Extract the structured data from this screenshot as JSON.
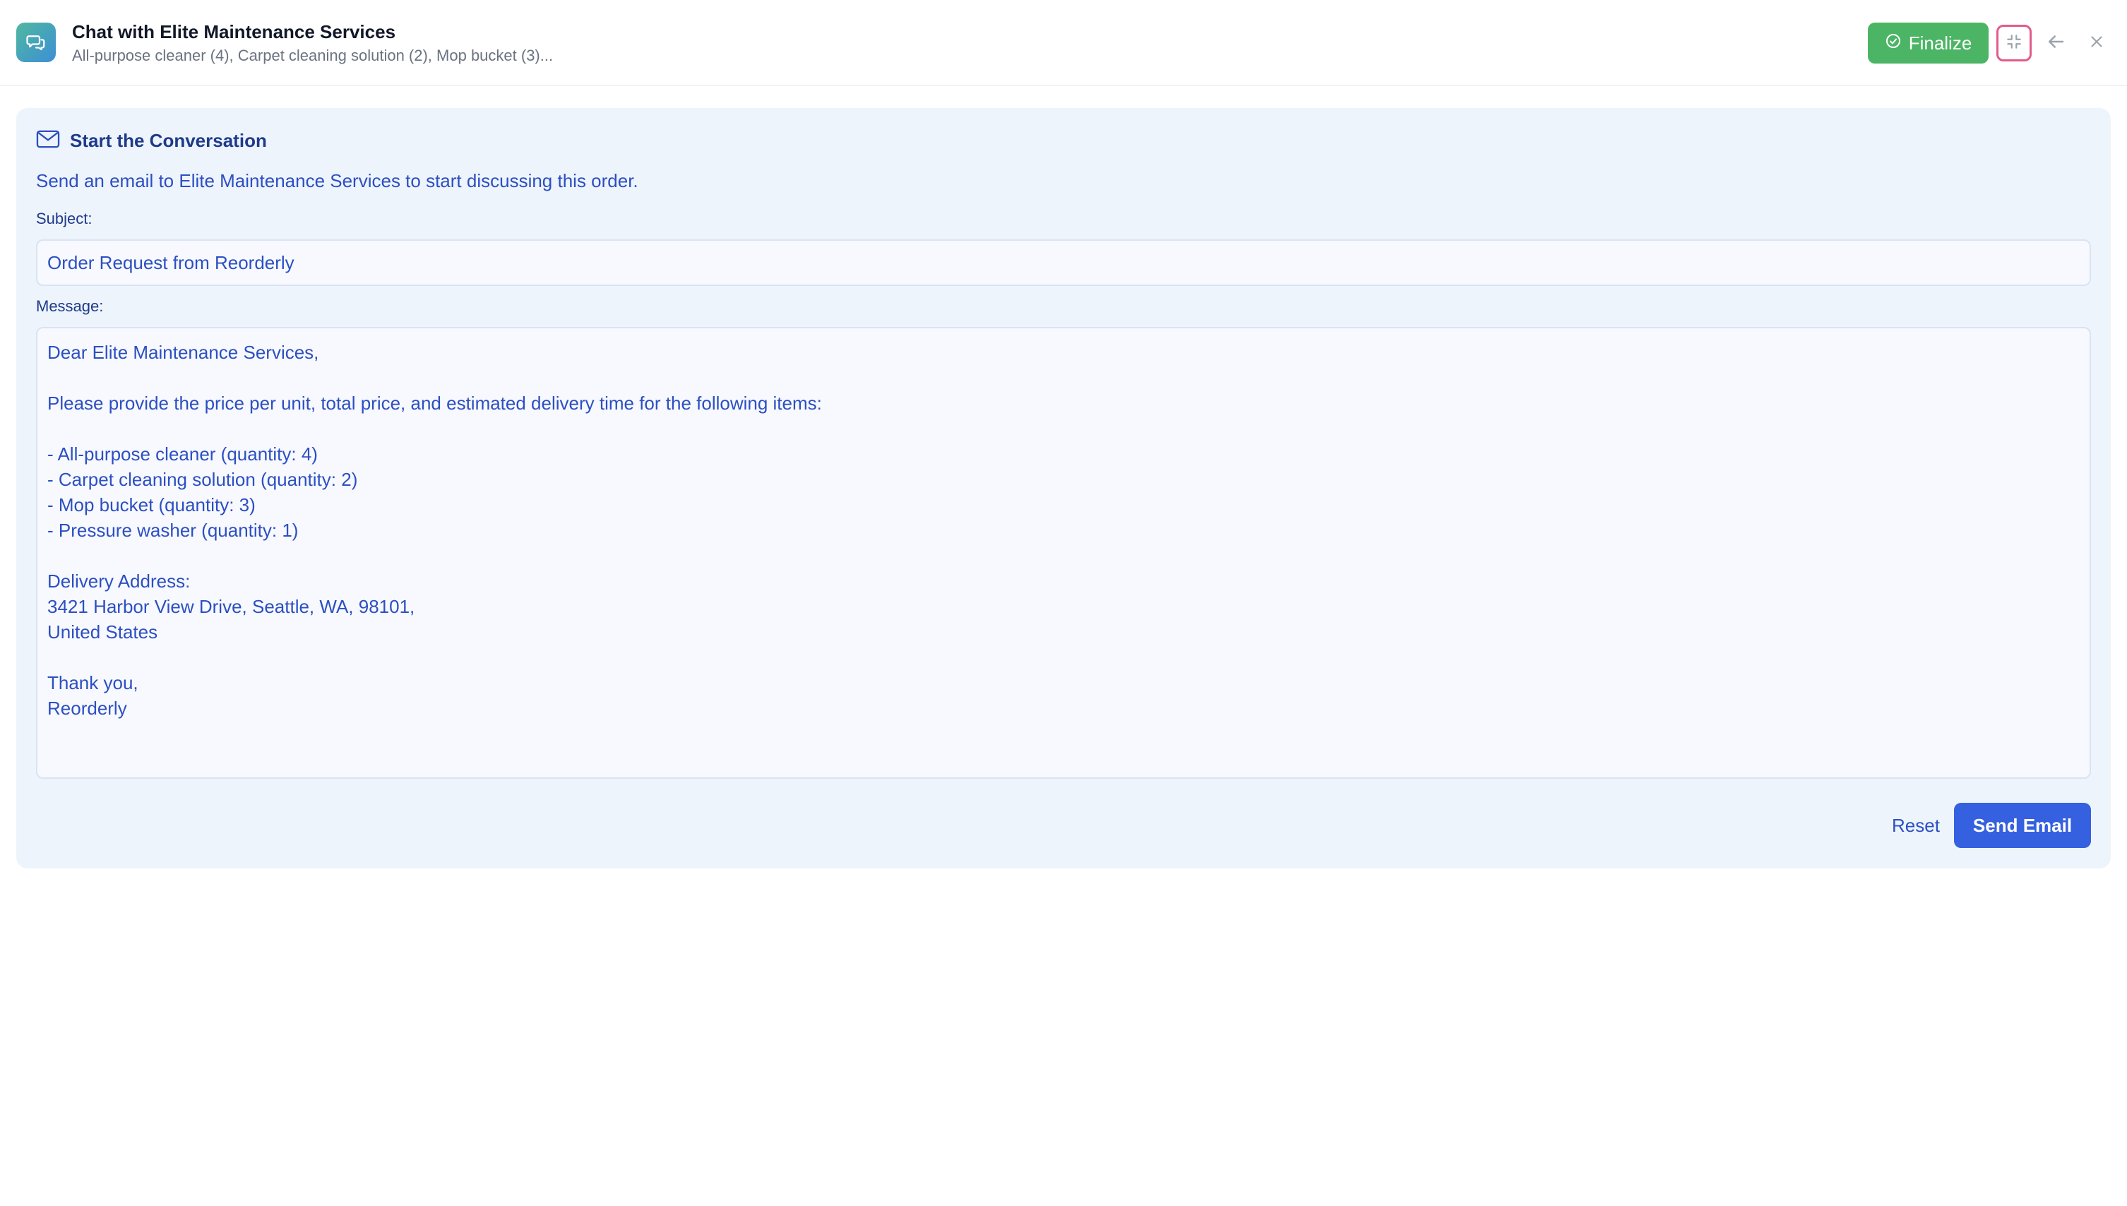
{
  "header": {
    "title": "Chat with Elite Maintenance Services",
    "subtitle": "All-purpose cleaner (4), Carpet cleaning solution (2), Mop bucket (3)...",
    "app_icon": "chat-bubbles-icon",
    "finalize_label": "Finalize",
    "finalize_icon": "check-circle-icon",
    "collapse_icon": "collapse-icon",
    "back_icon": "arrow-left-icon",
    "close_icon": "close-icon"
  },
  "card": {
    "heading": "Start the Conversation",
    "heading_icon": "mail-icon",
    "intro": "Send an email to Elite Maintenance Services to start discussing this order.",
    "subject_label": "Subject:",
    "subject_value": "Order Request from Reorderly",
    "message_label": "Message:",
    "message_value": "Dear Elite Maintenance Services,\n\nPlease provide the price per unit, total price, and estimated delivery time for the following items:\n\n- All-purpose cleaner (quantity: 4)\n- Carpet cleaning solution (quantity: 2)\n- Mop bucket (quantity: 3)\n- Pressure washer (quantity: 1)\n\nDelivery Address:\n3421 Harbor View Drive, Seattle, WA, 98101,\nUnited States\n\nThank you,\nReorderly",
    "reset_label": "Reset",
    "send_label": "Send Email"
  },
  "colors": {
    "finalize": "#4cb565",
    "send": "#3560e0",
    "card_bg": "#eef4fc",
    "text_blue": "#2c4fc2",
    "collapse_border": "#e25b8a"
  }
}
